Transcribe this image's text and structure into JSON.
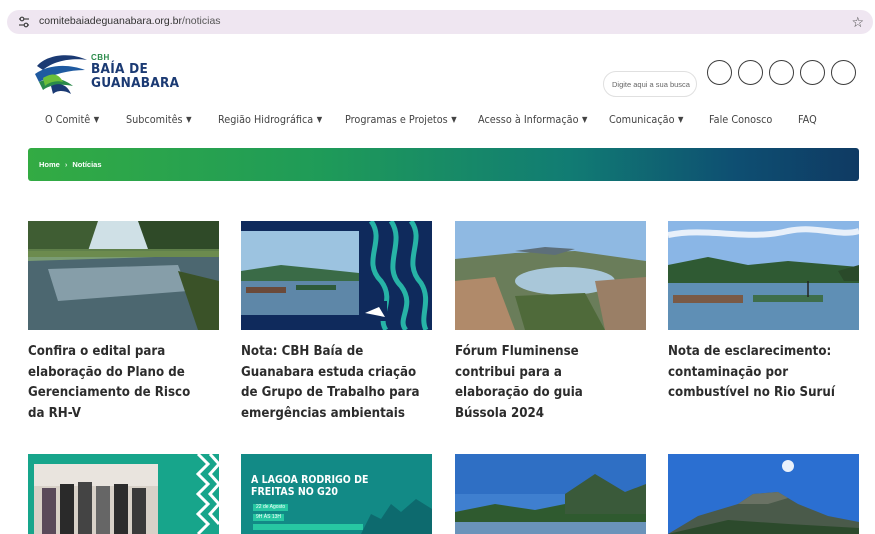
{
  "browser": {
    "url_domain": "comitebaiadeguanabara.org.br",
    "url_path": "/noticias"
  },
  "logo": {
    "small": "CBH",
    "line1": "BAÍA DE",
    "line2": "GUANABARA"
  },
  "search": {
    "placeholder": "Digite aqui a sua busca"
  },
  "nav": {
    "items": [
      {
        "label": "O Comitê",
        "dropdown": true
      },
      {
        "label": "Subcomitês",
        "dropdown": true
      },
      {
        "label": "Região Hidrográfica",
        "dropdown": true
      },
      {
        "label": "Programas e Projetos",
        "dropdown": true
      },
      {
        "label": "Acesso à Informação",
        "dropdown": true
      },
      {
        "label": "Comunicação",
        "dropdown": true
      },
      {
        "label": "Fale Conosco",
        "dropdown": false
      },
      {
        "label": "FAQ",
        "dropdown": false
      }
    ]
  },
  "breadcrumb": {
    "home": "Home",
    "current": "Notícias"
  },
  "news": [
    {
      "title": "Confira o edital para elaboração do Plano de Gerenciamento de Risco da RH-V"
    },
    {
      "title": "Nota: CBH Baía de Guanabara estuda criação de Grupo de Trabalho para emergências ambientais"
    },
    {
      "title": "Fórum Fluminense contribui para a elaboração do guia Bússola 2024"
    },
    {
      "title": "Nota de esclarecimento: contaminação por combustível no Rio Suruí"
    }
  ],
  "second_row": {
    "card2_heading": "A LAGOA RODRIGO DE FREITAS NO G20",
    "card2_date": "22 de Agosto",
    "card2_time": "9H ÀS 13H"
  },
  "colors": {
    "banner_start": "#33ab43",
    "banner_end": "#0f3a63",
    "logo_blue": "#1b3a73",
    "logo_green": "#2a8a4a"
  }
}
